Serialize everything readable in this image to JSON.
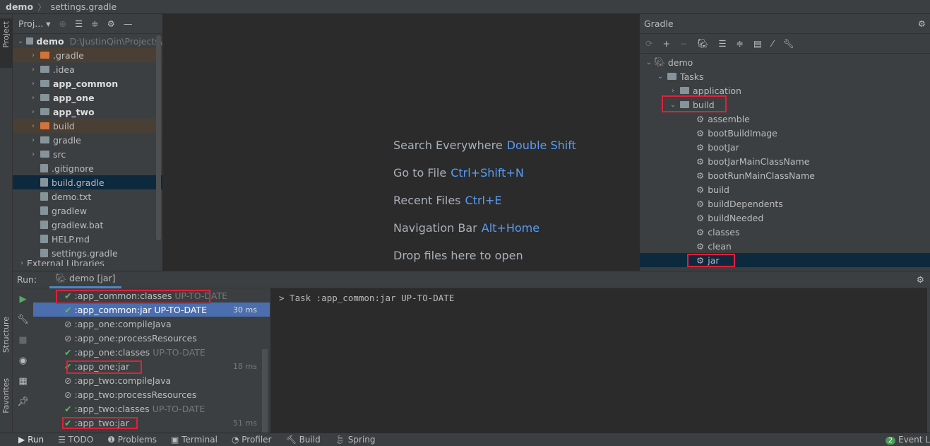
{
  "breadcrumb": {
    "project": "demo",
    "file": "settings.gradle"
  },
  "left_strip": {
    "project": "Project",
    "structure": "Structure",
    "favorites": "Favorites"
  },
  "project_panel": {
    "view": "Proj...",
    "root": {
      "name": "demo",
      "path": "D:\\JustinQin\\Projects\\"
    },
    "items": [
      {
        "name": ".gradle",
        "kind": "excluded",
        "expandable": true,
        "bold": false
      },
      {
        "name": ".idea",
        "kind": "folder",
        "expandable": true,
        "bold": false
      },
      {
        "name": "app_common",
        "kind": "module",
        "expandable": true,
        "bold": true
      },
      {
        "name": "app_one",
        "kind": "module",
        "expandable": true,
        "bold": true
      },
      {
        "name": "app_two",
        "kind": "module",
        "expandable": true,
        "bold": true
      },
      {
        "name": "build",
        "kind": "excluded",
        "expandable": true,
        "bold": false
      },
      {
        "name": "gradle",
        "kind": "folder",
        "expandable": true,
        "bold": false
      },
      {
        "name": "src",
        "kind": "folder",
        "expandable": true,
        "bold": false
      },
      {
        "name": ".gitignore",
        "kind": "file",
        "expandable": false,
        "bold": false
      },
      {
        "name": "build.gradle",
        "kind": "gradle",
        "expandable": false,
        "bold": false,
        "selected": true
      },
      {
        "name": "demo.txt",
        "kind": "file",
        "expandable": false,
        "bold": false
      },
      {
        "name": "gradlew",
        "kind": "file",
        "expandable": false,
        "bold": false
      },
      {
        "name": "gradlew.bat",
        "kind": "file",
        "expandable": false,
        "bold": false
      },
      {
        "name": "HELP.md",
        "kind": "file",
        "expandable": false,
        "bold": false
      },
      {
        "name": "settings.gradle",
        "kind": "gradle",
        "expandable": false,
        "bold": false
      }
    ],
    "external": "External Libraries"
  },
  "editor_hints": [
    {
      "label": "Search Everywhere",
      "shortcut": "Double Shift"
    },
    {
      "label": "Go to File",
      "shortcut": "Ctrl+Shift+N"
    },
    {
      "label": "Recent Files",
      "shortcut": "Ctrl+E"
    },
    {
      "label": "Navigation Bar",
      "shortcut": "Alt+Home"
    },
    {
      "label": "Drop files here to open",
      "shortcut": ""
    }
  ],
  "gradle": {
    "title": "Gradle",
    "root": "demo",
    "tasks": "Tasks",
    "groups": [
      "application",
      "build"
    ],
    "build_tasks": [
      "assemble",
      "bootBuildImage",
      "bootJar",
      "bootJarMainClassName",
      "bootRunMainClassName",
      "build",
      "buildDependents",
      "buildNeeded",
      "classes",
      "clean",
      "jar"
    ],
    "selected": "jar"
  },
  "run": {
    "label": "Run:",
    "tab": "demo [jar]",
    "tasks": [
      {
        "name": ":app_common:classes",
        "status": "UP-TO-DATE",
        "icon": "check",
        "time": ""
      },
      {
        "name": ":app_common:jar",
        "status": "UP-TO-DATE",
        "icon": "check",
        "time": "30 ms",
        "selected": true
      },
      {
        "name": ":app_one:compileJava",
        "status": "",
        "icon": "skip",
        "time": ""
      },
      {
        "name": ":app_one:processResources",
        "status": "",
        "icon": "skip",
        "time": ""
      },
      {
        "name": ":app_one:classes",
        "status": "UP-TO-DATE",
        "icon": "check",
        "time": ""
      },
      {
        "name": ":app_one:jar",
        "status": "",
        "icon": "check",
        "time": "18 ms"
      },
      {
        "name": ":app_two:compileJava",
        "status": "",
        "icon": "skip",
        "time": ""
      },
      {
        "name": ":app_two:processResources",
        "status": "",
        "icon": "skip",
        "time": ""
      },
      {
        "name": ":app_two:classes",
        "status": "UP-TO-DATE",
        "icon": "check",
        "time": ""
      },
      {
        "name": ":app_two:jar",
        "status": "",
        "icon": "check",
        "time": "51 ms"
      }
    ],
    "console": "> Task :app_common:jar UP-TO-DATE"
  },
  "statusbar": {
    "items": [
      "Run",
      "TODO",
      "Problems",
      "Terminal",
      "Profiler",
      "Build",
      "Spring"
    ],
    "event_count": "2",
    "event_log": "Event L"
  },
  "colors": {
    "accent": "#589df6",
    "highlight": "#e0203a",
    "selection": "#4b6eaf"
  }
}
